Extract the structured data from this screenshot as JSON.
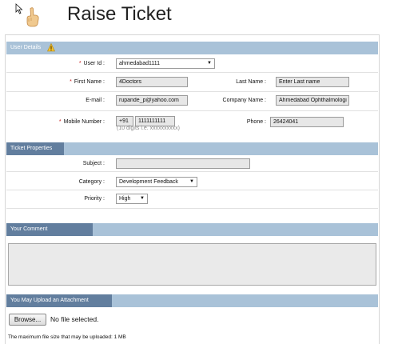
{
  "page": {
    "title": "Raise Ticket"
  },
  "user_details": {
    "section_title": "User Details",
    "user_id": {
      "label": "User Id :",
      "value": "ahmedabad1111"
    },
    "first_name": {
      "label": "First Name :",
      "value": "4Doctors"
    },
    "last_name": {
      "label": "Last Name :",
      "value": "Enter Last name"
    },
    "email": {
      "label": "E-mail :",
      "value": "rupande_p@yahoo.com"
    },
    "company_name": {
      "label": "Company Name :",
      "value": "Ahmedabad Ophthalmologic"
    },
    "mobile": {
      "label": "Mobile Number :",
      "country_code": "+91",
      "value": "1111111111",
      "hint": "(10 digits i.e. xxxxxxxxxx)"
    },
    "phone": {
      "label": "Phone :",
      "value": "26424041"
    }
  },
  "ticket_properties": {
    "section_title": "Ticket Properties",
    "subject": {
      "label": "Subject :",
      "value": ""
    },
    "category": {
      "label": "Category :",
      "value": "Development Feedback"
    },
    "priority": {
      "label": "Priority :",
      "value": "High"
    }
  },
  "comment": {
    "section_title": "Your Comment",
    "value": ""
  },
  "attachment": {
    "section_title": "You May Upload an Attachment",
    "browse_label": "Browse...",
    "no_file_text": "No file selected.",
    "max_size_text": "The maximum file size that may be uploaded: 1 MB"
  }
}
